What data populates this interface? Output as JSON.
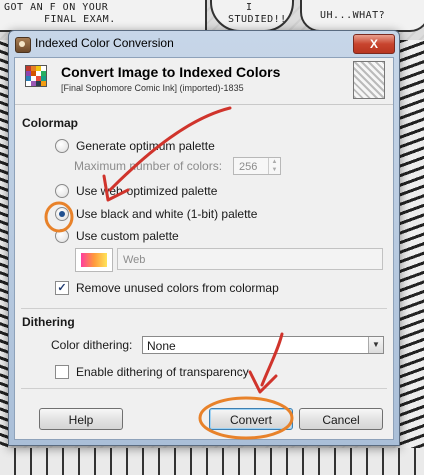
{
  "background": {
    "comic_lines": [
      "GOT AN F ON YOUR",
      "FINAL EXAM."
    ],
    "bubble_1": [
      "I",
      "STUDIED!!"
    ],
    "bubble_2": "UH...WHAT?"
  },
  "window": {
    "title": "Indexed Color Conversion",
    "close_label": "X"
  },
  "header": {
    "title": "Convert Image to Indexed Colors",
    "subtitle": "[Final Sophomore Comic Ink] (imported)-1835"
  },
  "colormap": {
    "section_title": "Colormap",
    "options": [
      {
        "label": "Generate optimum palette",
        "checked": false
      },
      {
        "label": "Use web-optimized palette",
        "checked": false
      },
      {
        "label": "Use black and white (1-bit) palette",
        "checked": true
      },
      {
        "label": "Use custom palette",
        "checked": false
      }
    ],
    "max_colors_label": "Maximum number of colors:",
    "max_colors_value": "256",
    "custom_palette_name": "Web",
    "remove_unused_label": "Remove unused colors from colormap",
    "remove_unused_checked": true
  },
  "dithering": {
    "section_title": "Dithering",
    "color_dithering_label": "Color dithering:",
    "color_dithering_value": "None",
    "transparency_label": "Enable dithering of transparency",
    "transparency_checked": false
  },
  "buttons": {
    "help": "Help",
    "convert": "Convert",
    "cancel": "Cancel"
  },
  "colors": {
    "annotation": "#d0342c",
    "annotation_circle": "#e8822a",
    "radio_dot": "#1f4f8f"
  }
}
